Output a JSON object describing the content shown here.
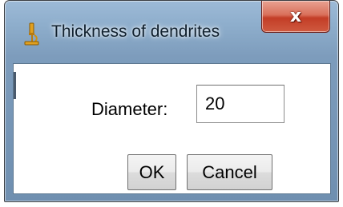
{
  "window": {
    "title": "Thickness of dendrites",
    "icon": "microscope-icon",
    "close_label": "x"
  },
  "form": {
    "diameter_label": "Diameter:",
    "diameter_value": "20"
  },
  "buttons": {
    "ok_label": "OK",
    "cancel_label": "Cancel"
  },
  "colors": {
    "title_bar": "#8eaecc",
    "close_button": "#c33d26",
    "icon_accent": "#e0a020"
  }
}
